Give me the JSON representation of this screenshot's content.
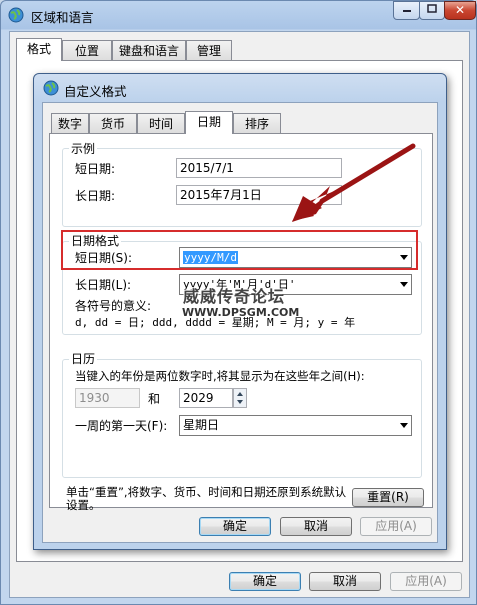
{
  "outer_window": {
    "title": "区域和语言",
    "tabs": [
      "格式",
      "位置",
      "键盘和语言",
      "管理"
    ],
    "ok": "确定",
    "cancel": "取消",
    "apply": "应用(A)"
  },
  "dialog": {
    "title": "自定义格式",
    "tabs": [
      "数字",
      "货币",
      "时间",
      "日期",
      "排序"
    ],
    "example": {
      "legend": "示例",
      "short_label": "短日期:",
      "short_value": "2015/7/1",
      "long_label": "长日期:",
      "long_value": "2015年7月1日"
    },
    "date_format": {
      "legend": "日期格式",
      "short_label": "短日期(S):",
      "short_value": "yyyy/M/d",
      "long_label": "长日期(L):",
      "long_value": "yyyy'年'M'月'd'日'",
      "meaning_label": "各符号的意义:",
      "meaning_text": "d, dd = 日;  ddd, dddd = 星期;  M = 月;  y = 年"
    },
    "calendar": {
      "legend": "日历",
      "two_digit_text": "当键入的年份是两位数字时,将其显示为在这些年之间(H):",
      "year_from": "1930",
      "and_label": "和",
      "year_to": "2029",
      "first_day_label": "一周的第一天(F):",
      "first_day_value": "星期日"
    },
    "reset_text": "单击“重置”,将数字、货币、时间和日期还原到系统默认设置。",
    "reset_button": "重置(R)",
    "ok": "确定",
    "cancel": "取消",
    "apply": "应用(A)"
  },
  "watermark": {
    "line1": "威威传奇论坛",
    "line2": "WWW.DPSGM.COM"
  },
  "colors": {
    "annotation": "#d62c2c",
    "arrow": "#9b1414",
    "selection": "#3399ff"
  }
}
